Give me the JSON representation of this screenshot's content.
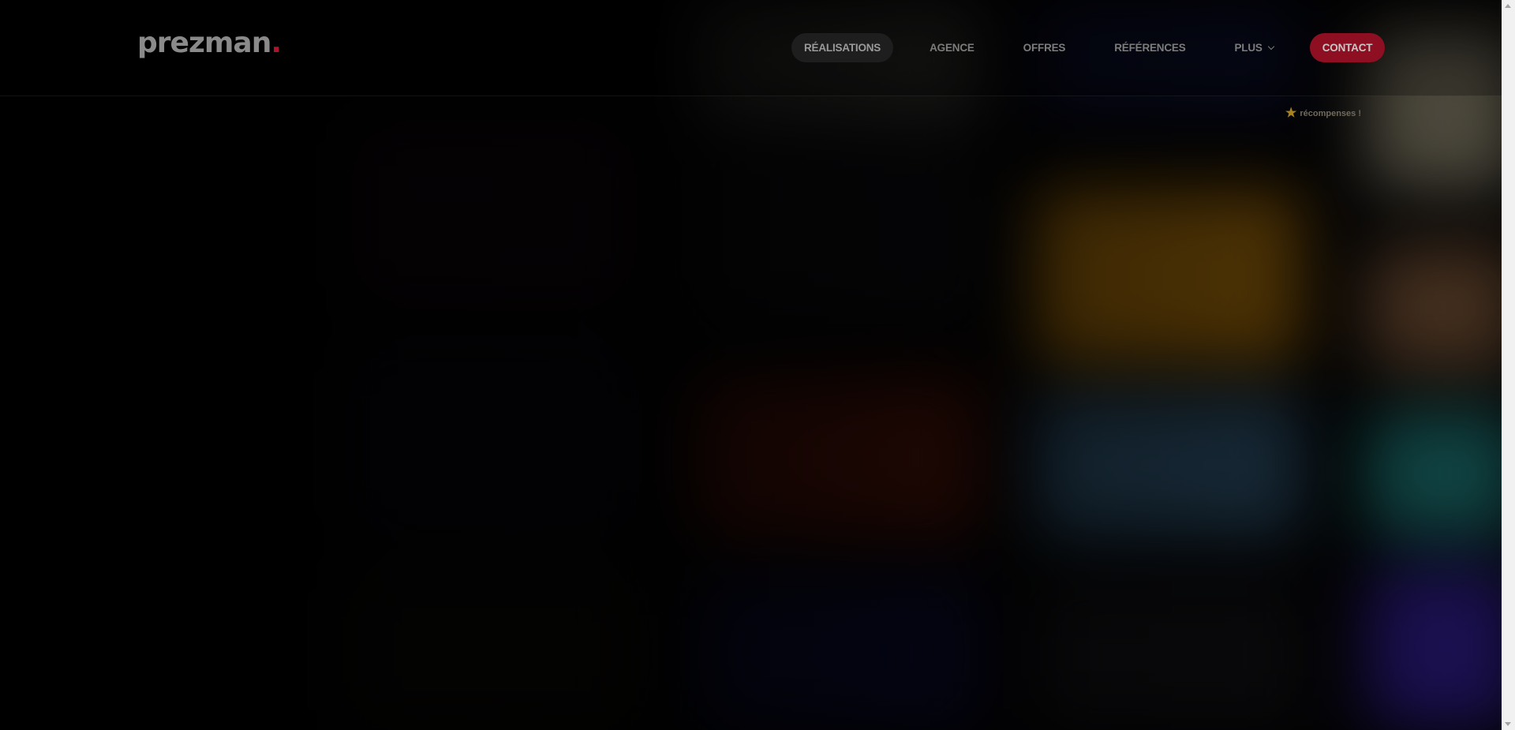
{
  "brand": {
    "name": "prezman",
    "dot": ".",
    "accent": "#b0142a"
  },
  "nav": {
    "items": [
      {
        "label": "RÉALISATIONS",
        "active": true
      },
      {
        "label": "AGENCE"
      },
      {
        "label": "OFFRES"
      },
      {
        "label": "RÉFÉRENCES"
      },
      {
        "label": "PLUS"
      }
    ],
    "contact_label": "CONTACT",
    "contact_color": "#8e0f22"
  },
  "awards": {
    "label": "récompenses !",
    "icon": "star-icon",
    "icon_color": "#a8821c"
  },
  "background": {
    "base_color": "#030304"
  }
}
